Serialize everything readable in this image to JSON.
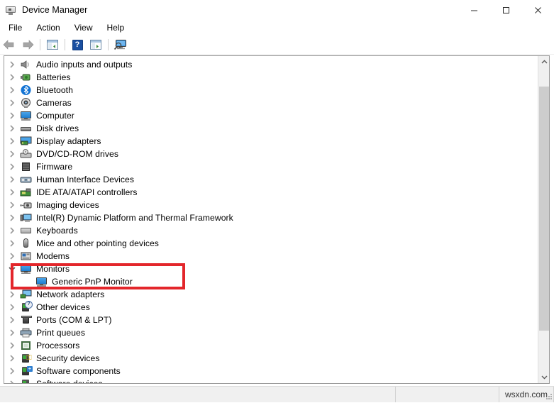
{
  "window": {
    "title": "Device Manager",
    "icon": "device-manager-icon",
    "controls": {
      "minimize": "—",
      "maximize": "□",
      "close": "✕"
    }
  },
  "menubar": {
    "items": [
      {
        "label": "File"
      },
      {
        "label": "Action"
      },
      {
        "label": "View"
      },
      {
        "label": "Help"
      }
    ]
  },
  "toolbar": {
    "buttons": [
      {
        "name": "back-button",
        "icon": "back-arrow-icon",
        "title": "Back"
      },
      {
        "name": "forward-button",
        "icon": "forward-arrow-icon",
        "title": "Forward"
      },
      {
        "name": "show-hide-console-tree-button",
        "icon": "console-tree-icon",
        "title": "Show/Hide Console Tree"
      },
      {
        "name": "help-button",
        "icon": "help-question-icon",
        "title": "Help"
      },
      {
        "name": "properties-button",
        "icon": "properties-window-icon",
        "title": "Properties"
      },
      {
        "name": "scan-hardware-changes-button",
        "icon": "scan-monitor-icon",
        "title": "Scan for hardware changes"
      }
    ]
  },
  "tree": {
    "nodes": [
      {
        "label": "Audio inputs and outputs",
        "icon": "speaker-icon",
        "expanded": false,
        "level": 0
      },
      {
        "label": "Batteries",
        "icon": "battery-icon",
        "expanded": false,
        "level": 0
      },
      {
        "label": "Bluetooth",
        "icon": "bluetooth-icon",
        "expanded": false,
        "level": 0
      },
      {
        "label": "Cameras",
        "icon": "camera-icon",
        "expanded": false,
        "level": 0
      },
      {
        "label": "Computer",
        "icon": "computer-monitor-icon",
        "expanded": false,
        "level": 0
      },
      {
        "label": "Disk drives",
        "icon": "disk-drive-icon",
        "expanded": false,
        "level": 0
      },
      {
        "label": "Display adapters",
        "icon": "display-adapter-icon",
        "expanded": false,
        "level": 0
      },
      {
        "label": "DVD/CD-ROM drives",
        "icon": "optical-drive-icon",
        "expanded": false,
        "level": 0
      },
      {
        "label": "Firmware",
        "icon": "firmware-chip-icon",
        "expanded": false,
        "level": 0
      },
      {
        "label": "Human Interface Devices",
        "icon": "hid-icon",
        "expanded": false,
        "level": 0
      },
      {
        "label": "IDE ATA/ATAPI controllers",
        "icon": "ide-controller-icon",
        "expanded": false,
        "level": 0
      },
      {
        "label": "Imaging devices",
        "icon": "imaging-device-icon",
        "expanded": false,
        "level": 0
      },
      {
        "label": "Intel(R) Dynamic Platform and Thermal Framework",
        "icon": "thermal-framework-icon",
        "expanded": false,
        "level": 0
      },
      {
        "label": "Keyboards",
        "icon": "keyboard-icon",
        "expanded": false,
        "level": 0
      },
      {
        "label": "Mice and other pointing devices",
        "icon": "mouse-icon",
        "expanded": false,
        "level": 0
      },
      {
        "label": "Modems",
        "icon": "modem-icon",
        "expanded": false,
        "level": 0
      },
      {
        "label": "Monitors",
        "icon": "monitor-icon",
        "expanded": true,
        "level": 0,
        "highlighted": true
      },
      {
        "label": "Generic PnP Monitor",
        "icon": "monitor-icon",
        "expanded": null,
        "level": 1,
        "highlighted": true
      },
      {
        "label": "Network adapters",
        "icon": "network-adapter-icon",
        "expanded": false,
        "level": 0
      },
      {
        "label": "Other devices",
        "icon": "unknown-device-icon",
        "expanded": false,
        "level": 0
      },
      {
        "label": "Ports (COM & LPT)",
        "icon": "port-icon",
        "expanded": false,
        "level": 0
      },
      {
        "label": "Print queues",
        "icon": "printer-icon",
        "expanded": false,
        "level": 0
      },
      {
        "label": "Processors",
        "icon": "processor-icon",
        "expanded": false,
        "level": 0
      },
      {
        "label": "Security devices",
        "icon": "security-device-icon",
        "expanded": false,
        "level": 0
      },
      {
        "label": "Software components",
        "icon": "software-component-icon",
        "expanded": false,
        "level": 0
      },
      {
        "label": "Software devices",
        "icon": "software-device-icon",
        "expanded": false,
        "level": 0
      }
    ]
  },
  "highlight": {
    "color": "#e3262b",
    "targets": [
      "Monitors",
      "Generic PnP Monitor"
    ]
  },
  "scrollbar": {
    "up_arrow": "⌃",
    "down_arrow": "⌄"
  },
  "statusbar": {
    "pane1": "",
    "pane2": "",
    "watermark": "wsxdn.com"
  },
  "colors": {
    "accent_blue": "#1f7fd0",
    "highlight_red": "#e3262b",
    "chrome": "#ffffff",
    "status_bg": "#f0f0f0"
  }
}
